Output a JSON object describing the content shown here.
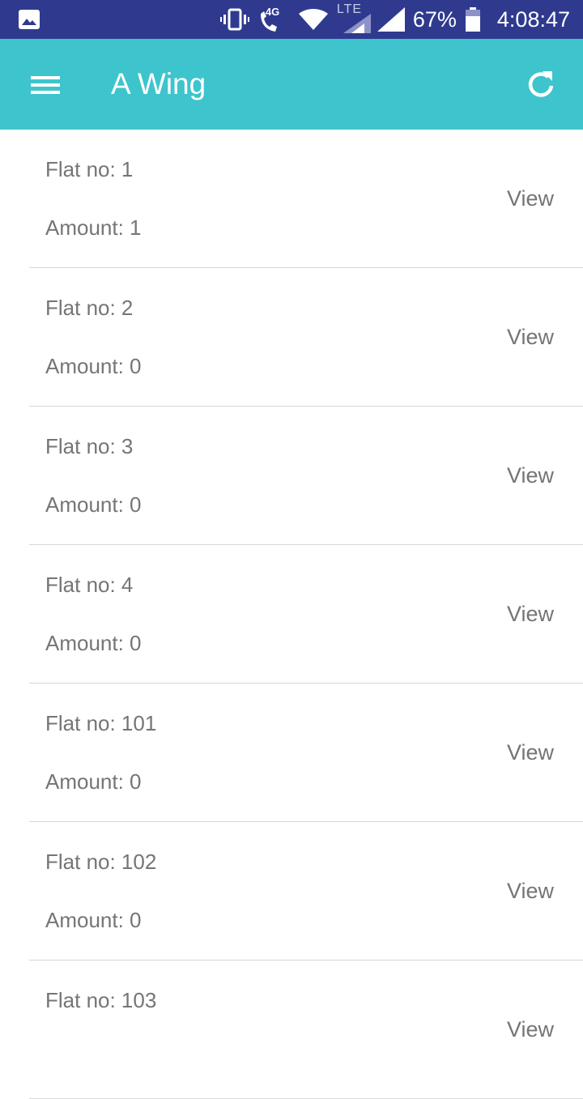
{
  "status_bar": {
    "network_4g_label": "4G",
    "lte_label": "LTE",
    "battery": "67%",
    "time": "4:08:47"
  },
  "app_bar": {
    "title": "A Wing"
  },
  "flats": [
    {
      "flat": "Flat no: 1",
      "amount": "Amount: 1",
      "action": "View"
    },
    {
      "flat": "Flat no: 2",
      "amount": "Amount: 0",
      "action": "View"
    },
    {
      "flat": "Flat no: 3",
      "amount": "Amount: 0",
      "action": "View"
    },
    {
      "flat": "Flat no: 4",
      "amount": "Amount: 0",
      "action": "View"
    },
    {
      "flat": "Flat no: 101",
      "amount": "Amount: 0",
      "action": "View"
    },
    {
      "flat": "Flat no: 102",
      "amount": "Amount: 0",
      "action": "View"
    },
    {
      "flat": "Flat no: 103",
      "amount": "",
      "action": "View"
    }
  ],
  "colors": {
    "status_bar": "#2f3a8f",
    "app_bar": "#3ec4cc",
    "text_secondary": "#757575",
    "divider": "#d6d6d6"
  }
}
